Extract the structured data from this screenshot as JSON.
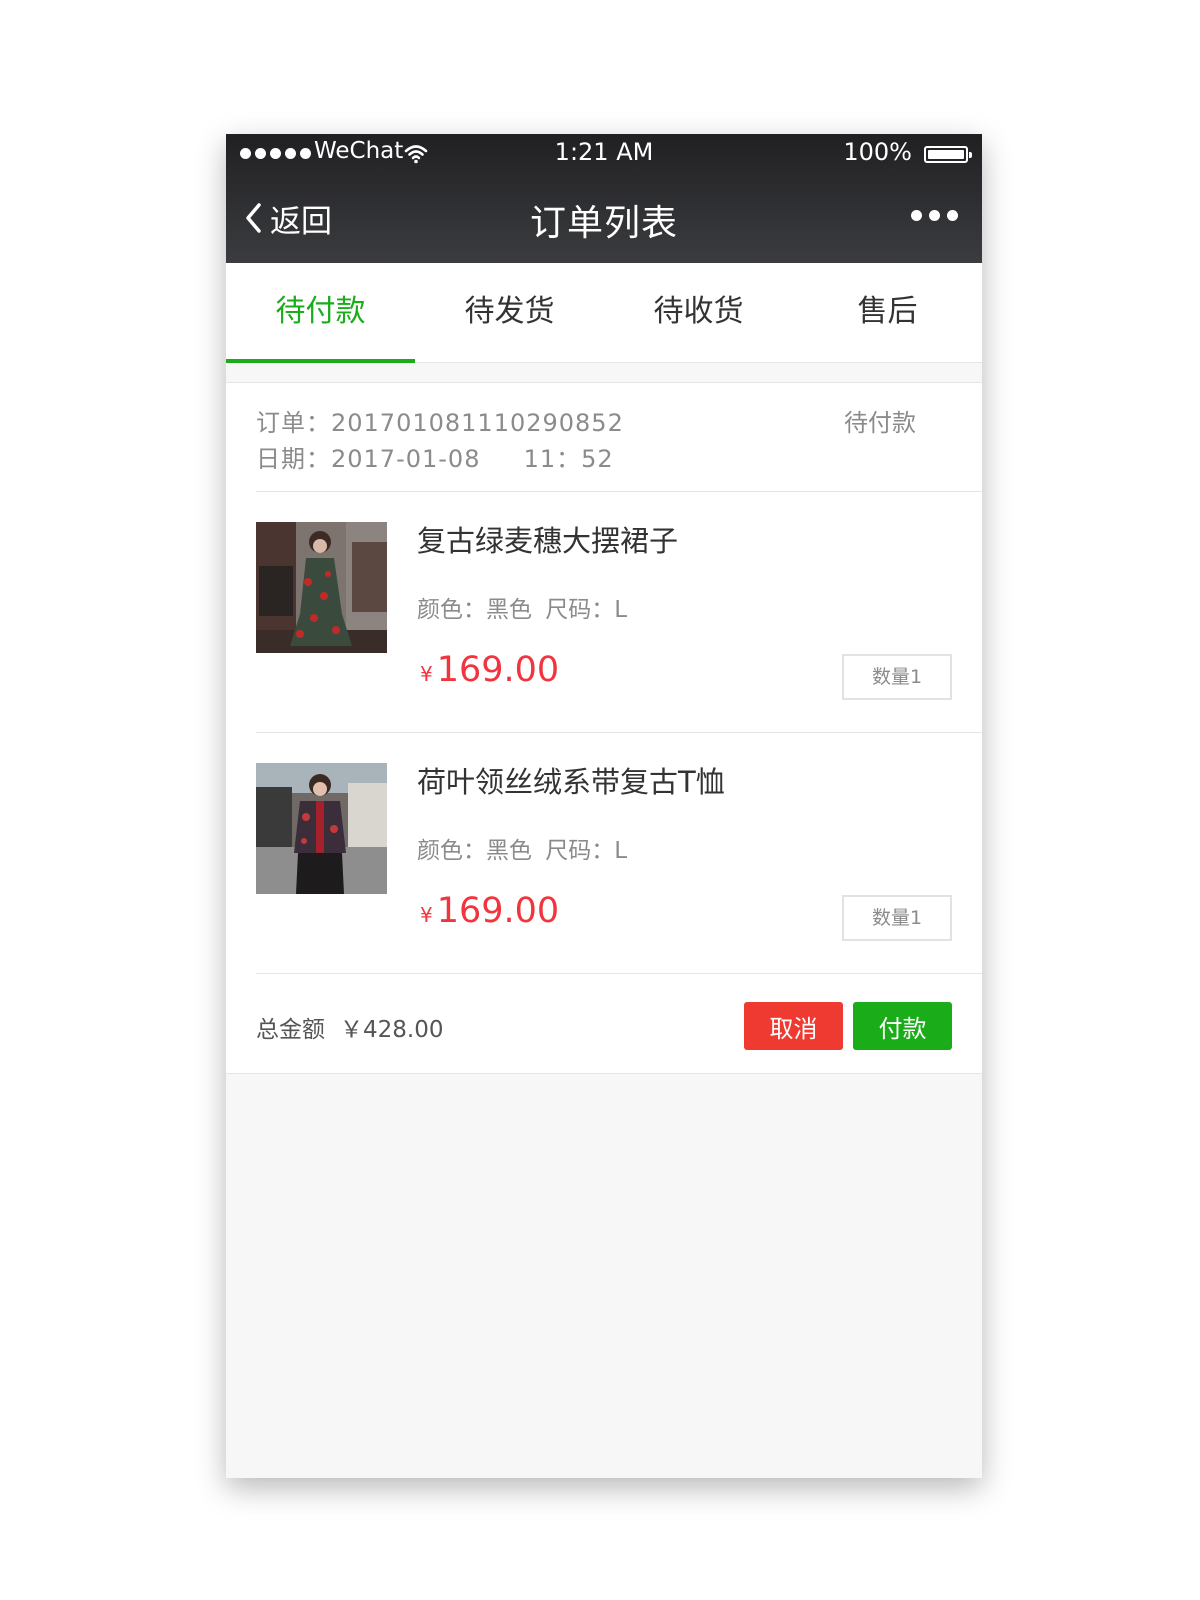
{
  "status_bar": {
    "carrier": "WeChat",
    "time": "1:21 AM",
    "battery": "100%"
  },
  "nav": {
    "back_label": "返回",
    "title": "订单列表"
  },
  "tabs": [
    {
      "label": "待付款",
      "active": true
    },
    {
      "label": "待发货",
      "active": false
    },
    {
      "label": "待收货",
      "active": false
    },
    {
      "label": "售后",
      "active": false
    }
  ],
  "order": {
    "number": "订单：20170108111029085​2",
    "date": "日期：2017-01-08     11：52",
    "status": "待付款",
    "items": [
      {
        "title": "复古绿麦穗大摆裙子",
        "spec": "颜色：黑色  尺码：L",
        "currency": "¥",
        "price": "169.00",
        "quantity": "数量1"
      },
      {
        "title": "荷叶领丝绒系带复古T恤",
        "spec": "颜色：黑色  尺码：L",
        "currency": "¥",
        "price": "169.00",
        "quantity": "数量1"
      }
    ],
    "total_label": "总金额",
    "total_value": "￥428.00",
    "cancel_label": "取消",
    "pay_label": "付款"
  },
  "colors": {
    "accent_green": "#1aad19",
    "price_red": "#f1353e",
    "cancel_red": "#ef3a32",
    "nav_bg": "#2f3033"
  }
}
